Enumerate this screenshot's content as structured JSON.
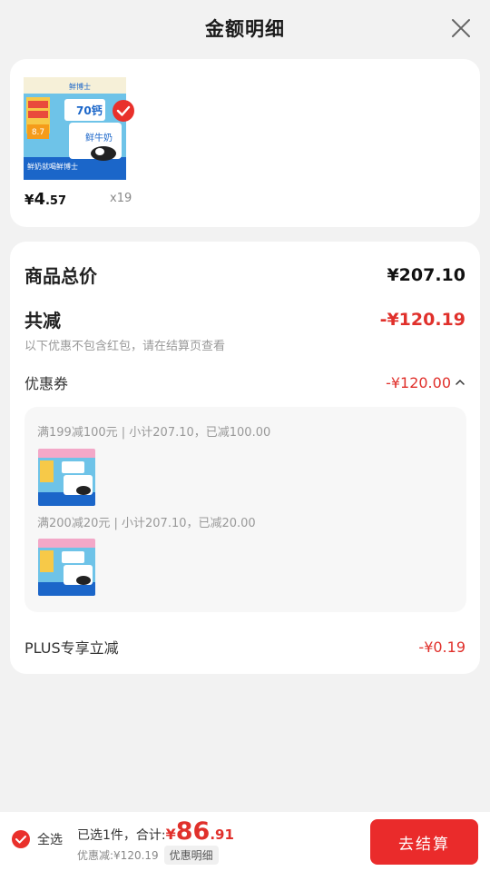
{
  "header": {
    "title": "金额明细"
  },
  "product": {
    "price_symbol": "¥",
    "price_int": "4",
    "price_dec": ".57",
    "quantity": "x19",
    "image_texts": {
      "brand": "鲜博士",
      "calcium": "70钙",
      "name": "鲜牛奶",
      "deal1": "2件9折",
      "deal2": "3件8折",
      "deal_price": "8.7",
      "slogan": "鲜奶就喝鲜博士"
    }
  },
  "detail": {
    "total_label": "商品总价",
    "total_amount": "¥207.10",
    "discount_label": "共减",
    "discount_amount": "-¥120.19",
    "hint": "以下优惠不包含红包，请在结算页查看",
    "coupon_label": "优惠券",
    "coupon_amount": "-¥120.00",
    "coupon_rule_1": "满199减100元 | 小计207.10，已减100.00",
    "coupon_rule_2": "满200减20元 | 小计207.10，已减20.00",
    "plus_label": "PLUS专享立减",
    "plus_amount": "-¥0.19"
  },
  "bottom": {
    "select_all": "全选",
    "selected_text": "已选1件，合计:",
    "total_symbol": "¥",
    "total_int": "86",
    "total_dec": ".91",
    "discount_text": "优惠减:¥120.19",
    "detail_link": "优惠明细",
    "checkout": "去结算"
  },
  "colors": {
    "accent_red": "#e0302b",
    "button_red": "#ea2b2b",
    "background": "#f2f2f2"
  },
  "icons": {
    "close": "close-icon",
    "check": "check-circle-icon",
    "chevron": "chevron-up-icon"
  }
}
